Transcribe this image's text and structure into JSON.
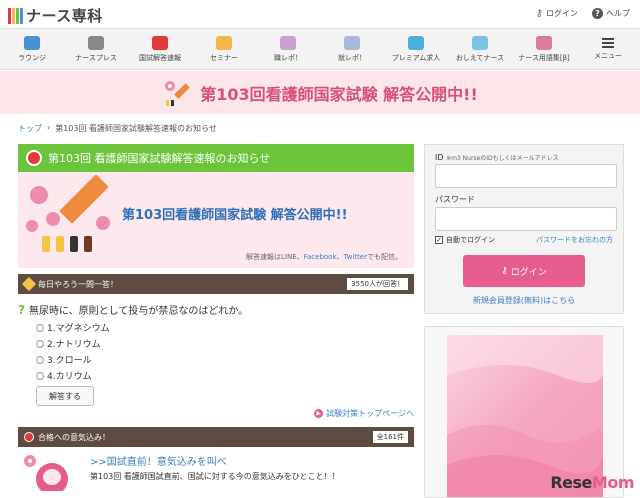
{
  "header": {
    "logo_text": "ナース専科",
    "login_label": "ログイン",
    "help_label": "ヘルプ"
  },
  "nav": [
    {
      "label": "ラウンジ",
      "color": "#4a90d9"
    },
    {
      "label": "ナースプレス",
      "color": "#888888"
    },
    {
      "label": "国試解答速報",
      "color": "#e23a3a"
    },
    {
      "label": "セミナー",
      "color": "#f2b84a"
    },
    {
      "label": "職レポ！",
      "color": "#c9a0d0"
    },
    {
      "label": "就レポ！",
      "color": "#a8b8d8"
    },
    {
      "label": "プレミアム求人",
      "color": "#4ab0d9"
    },
    {
      "label": "おしえてナース",
      "color": "#7ac4e0"
    },
    {
      "label": "ナース用語集[β]",
      "color": "#e07aa0"
    },
    {
      "label": "メニュー",
      "color": "#444444"
    }
  ],
  "banner": {
    "title": "第103回看護師国家試験 解答公開中!!"
  },
  "breadcrumb": {
    "home": "トップ",
    "separator": "›",
    "current": "第103回 看護師国家試験解答速報のお知らせ"
  },
  "main": {
    "title": "第103回 看護師国家試験解答速報のお知らせ",
    "promo_title": "第103回看護師国家試験 解答公開中!!",
    "promo_sub_prefix": "解答速報はLINE、",
    "promo_sub_fb": "Facebook",
    "promo_sub_mid": "、",
    "promo_sub_tw": "Twitter",
    "promo_sub_suffix": "でも配信。",
    "quiz_bar_label": "毎日やろう一問一答！",
    "quiz_count": "3550人が回答！",
    "question": "無尿時に、原則として投与が禁忌なのはどれか。",
    "options": [
      "1.マグネシウム",
      "2.ナトリウム",
      "3.クロール",
      "4.カリウム"
    ],
    "answer_button": "解答する",
    "more_link": "試験対策トップページへ",
    "motivation_bar_label": "合格への意気込み！",
    "motivation_count": "全161件",
    "article_title": ">>国試直前！意気込みを叫べ",
    "article_text": "第103回 看護師国試直前、国試に対する今の意気込みをひとこと！！"
  },
  "sidebar": {
    "id_label": "ID",
    "id_note": "※m3 NurseのIDもしくはメールアドレス",
    "password_label": "パスワード",
    "remember_label": "自動でログイン",
    "forgot_link": "パスワードをお忘れの方",
    "login_button": "ログイン",
    "register_link": "新規会員登録(無料)はこちら"
  },
  "watermark": {
    "rese": "Rese",
    "mom": "Mom"
  }
}
